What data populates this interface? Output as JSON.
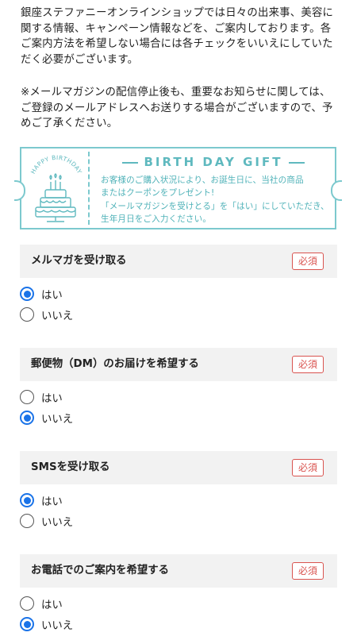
{
  "intro": {
    "paragraph1": "銀座ステファニーオンラインショップでは日々の出来事、美容に関する情報、キャンペーン情報などを、ご案内しております。各ご案内方法を希望しない場合には各チェックをいいえにしていただく必要がございます。",
    "paragraph2": "※メールマガジンの配信停止後も、重要なお知らせに関しては、ご登録のメールアドレスへお送りする場合がございますので、予めご了承ください。"
  },
  "birthday": {
    "badge_text": "HAPPY BIRTHDAY",
    "title": "BIRTH DAY GIFT",
    "lines": [
      "お客様のご購入状況により、お誕生日に、当社の商品",
      "またはクーポンをプレゼント!",
      "「メールマガジンを受けとる」を「はい」にしていただき、",
      "生年月日をご入力ください。"
    ],
    "accent_color": "#5fb9bf"
  },
  "required_label": "必須",
  "option_yes": "はい",
  "option_no": "いいえ",
  "sections": [
    {
      "title": "メルマガを受け取る",
      "selected": "はい"
    },
    {
      "title": "郵便物（DM）のお届けを希望する",
      "selected": "いいえ"
    },
    {
      "title": "SMSを受け取る",
      "selected": "はい"
    },
    {
      "title": "お電話でのご案内を希望する",
      "selected": "いいえ"
    }
  ],
  "colors": {
    "radio_selected": "#1a73e8",
    "required_badge": "#d9534f",
    "section_bg": "#f2f2f2"
  }
}
